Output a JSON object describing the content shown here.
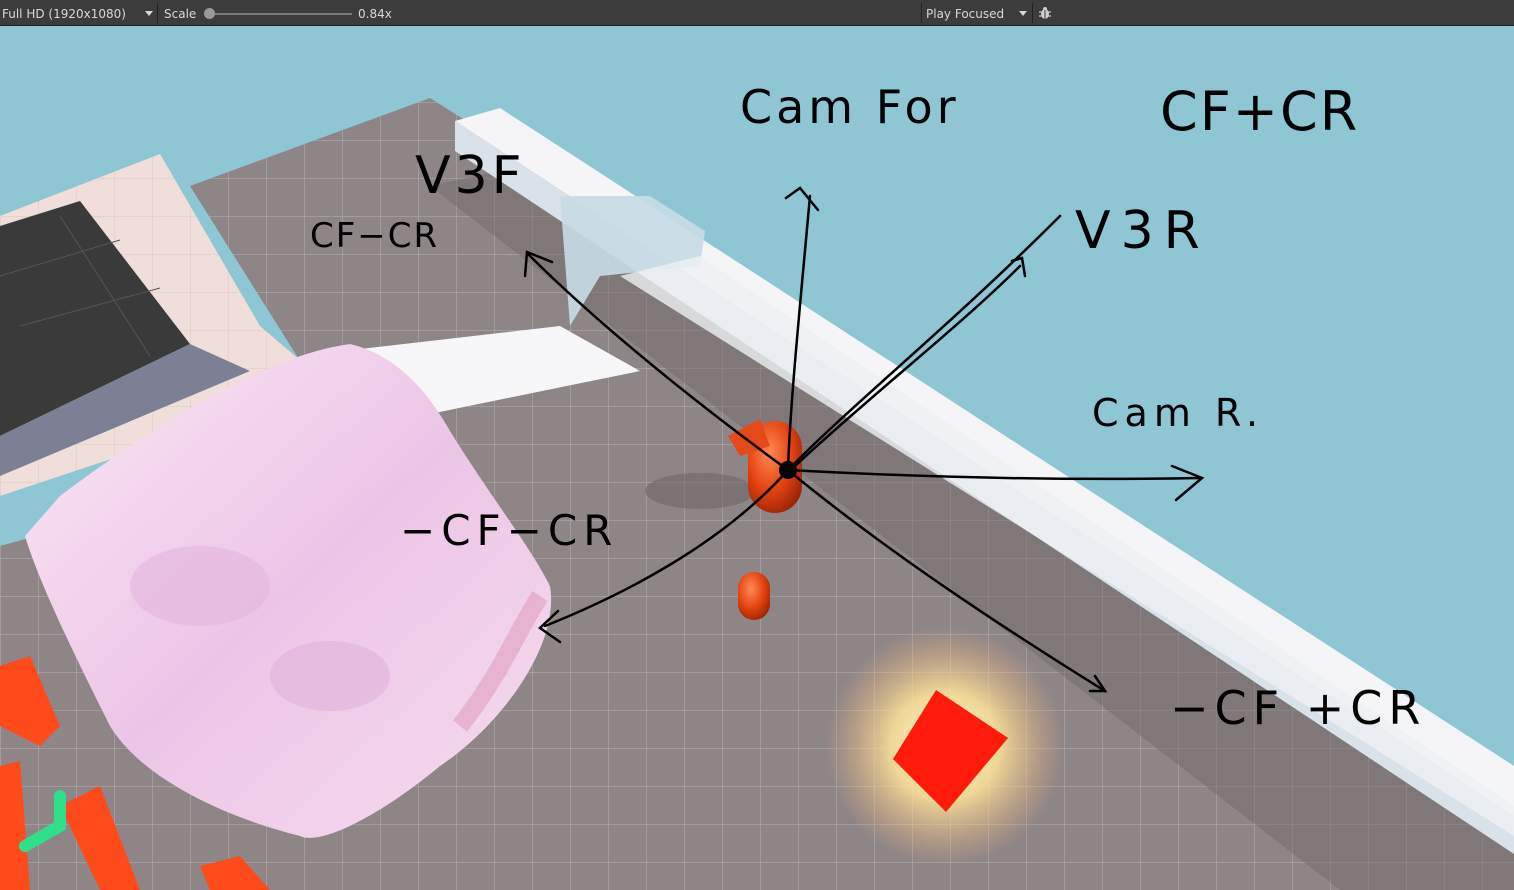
{
  "toolbar": {
    "resolution_label": "Full HD (1920x1080)",
    "scale_label": "Scale",
    "scale_value": "0.84x",
    "scale_slider_fraction": 0.02,
    "play_mode_label": "Play Focused",
    "bug_icon": "bug-icon"
  },
  "annotations": {
    "cam_for": "Cam For",
    "cf_plus_cr": "CF+CR",
    "v3f": "V3F",
    "cf_minus_cr": "CF−CR",
    "v3r": "V3R",
    "cam_r": "Cam R.",
    "neg_cf_minus_cr": "−CF−CR",
    "neg_cf_plus_cr": "−CF +CR"
  },
  "colors": {
    "sky": "#8fc6d4",
    "floor": "#8e8587",
    "wall": "#f2f2f4",
    "player": "#e2410f",
    "cube": "#ff1a0a",
    "toolbar": "#3c3c3c"
  }
}
